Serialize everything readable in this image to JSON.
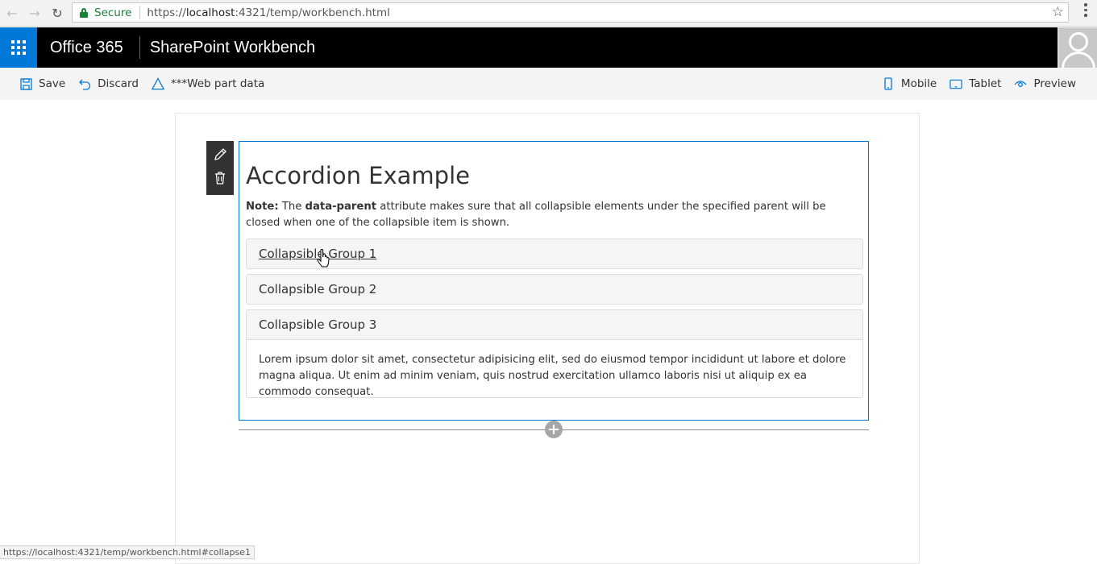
{
  "browser": {
    "secure_label": "Secure",
    "url_scheme": "https://",
    "url_host": "localhost",
    "url_rest": ":4321/temp/workbench.html"
  },
  "suite": {
    "brand": "Office 365",
    "app_title": "SharePoint Workbench"
  },
  "commands": {
    "save": "Save",
    "discard": "Discard",
    "web_part_data": "***Web part data",
    "mobile": "Mobile",
    "tablet": "Tablet",
    "preview": "Preview"
  },
  "webpart": {
    "title": "Accordion Example",
    "note_label": "Note:",
    "note_pre": " The ",
    "note_attr": "data-parent",
    "note_post": " attribute makes sure that all collapsible elements under the specified parent will be closed when one of the collapsible item is shown.",
    "groups": [
      {
        "label": "Collapsible Group 1"
      },
      {
        "label": "Collapsible Group 2"
      },
      {
        "label": "Collapsible Group 3"
      }
    ],
    "expanded_body": "Lorem ipsum dolor sit amet, consectetur adipisicing elit, sed do eiusmod tempor incididunt ut labore et dolore magna aliqua. Ut enim ad minim veniam, quis nostrud exercitation ullamco laboris nisi ut aliquip ex ea commodo consequat."
  },
  "status": {
    "link_url": "https://localhost:4321/temp/workbench.html#collapse1"
  },
  "colors": {
    "accent": "#0078d7",
    "suite_bg": "#000000",
    "secure": "#188038"
  }
}
